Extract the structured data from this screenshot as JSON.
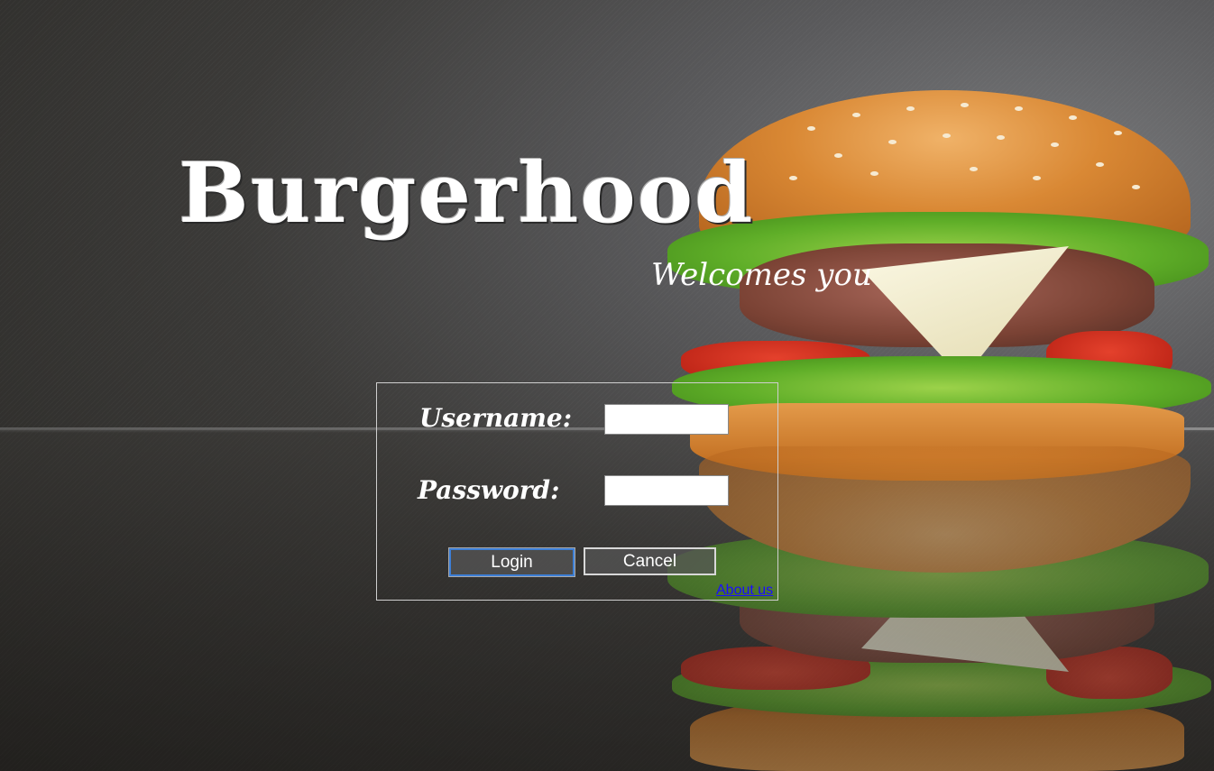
{
  "brand": {
    "title": "Burgerhood",
    "tagline": "Welcomes you"
  },
  "login": {
    "username_label": "Username:",
    "username_value": "",
    "password_label": "Password:",
    "password_value": "",
    "login_button": "Login",
    "cancel_button": "Cancel",
    "about_link": "About us"
  },
  "colors": {
    "link": "#1a0dff",
    "focus_border": "#3d7fd6",
    "text": "#ffffff"
  }
}
